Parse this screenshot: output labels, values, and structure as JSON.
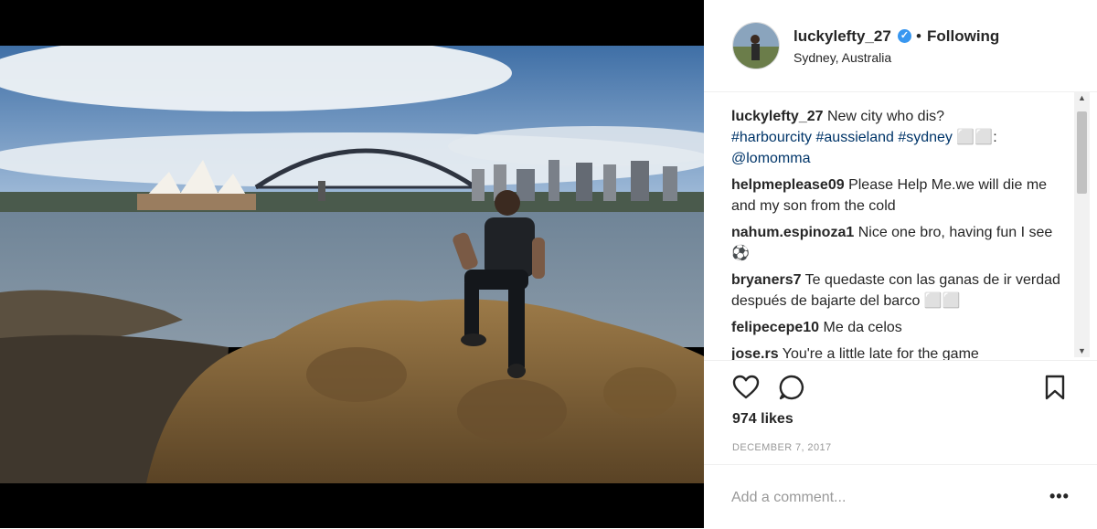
{
  "post": {
    "username": "luckylefty_27",
    "follow_status": "Following",
    "separator": "•",
    "location": "Sydney, Australia",
    "verified_icon": "verified-badge-icon"
  },
  "caption": {
    "user": "luckylefty_27",
    "text": "New city who dis?",
    "hashtags": "#harbourcity #aussieland #sydney",
    "emoji": "⬜⬜:",
    "mention": "@lomomma"
  },
  "comments": [
    {
      "user": "helpmeplease09",
      "text": "Please Help Me.we will die me and my son from the cold"
    },
    {
      "user": "nahum.espinoza1",
      "text": "Nice one bro, having fun I see ⚽"
    },
    {
      "user": "bryaners7",
      "text": "Te quedaste con las ganas de ir verdad después de bajarte del barco ⬜⬜"
    },
    {
      "user": "felipecepe10",
      "text": "Me da celos"
    },
    {
      "user": "jose.rs",
      "text": "You're a little late for the game"
    }
  ],
  "actions": {
    "like_icon": "heart-icon",
    "comment_icon": "comment-bubble-icon",
    "save_icon": "bookmark-icon"
  },
  "likes": "974 likes",
  "date": "DECEMBER 7, 2017",
  "add_comment": {
    "placeholder": "Add a comment...",
    "more": "•••"
  },
  "scrollbar": {
    "up": "▲",
    "down": "▼"
  },
  "colors": {
    "link": "#003569",
    "verified": "#3897f0",
    "text": "#262626",
    "muted": "#999999"
  }
}
